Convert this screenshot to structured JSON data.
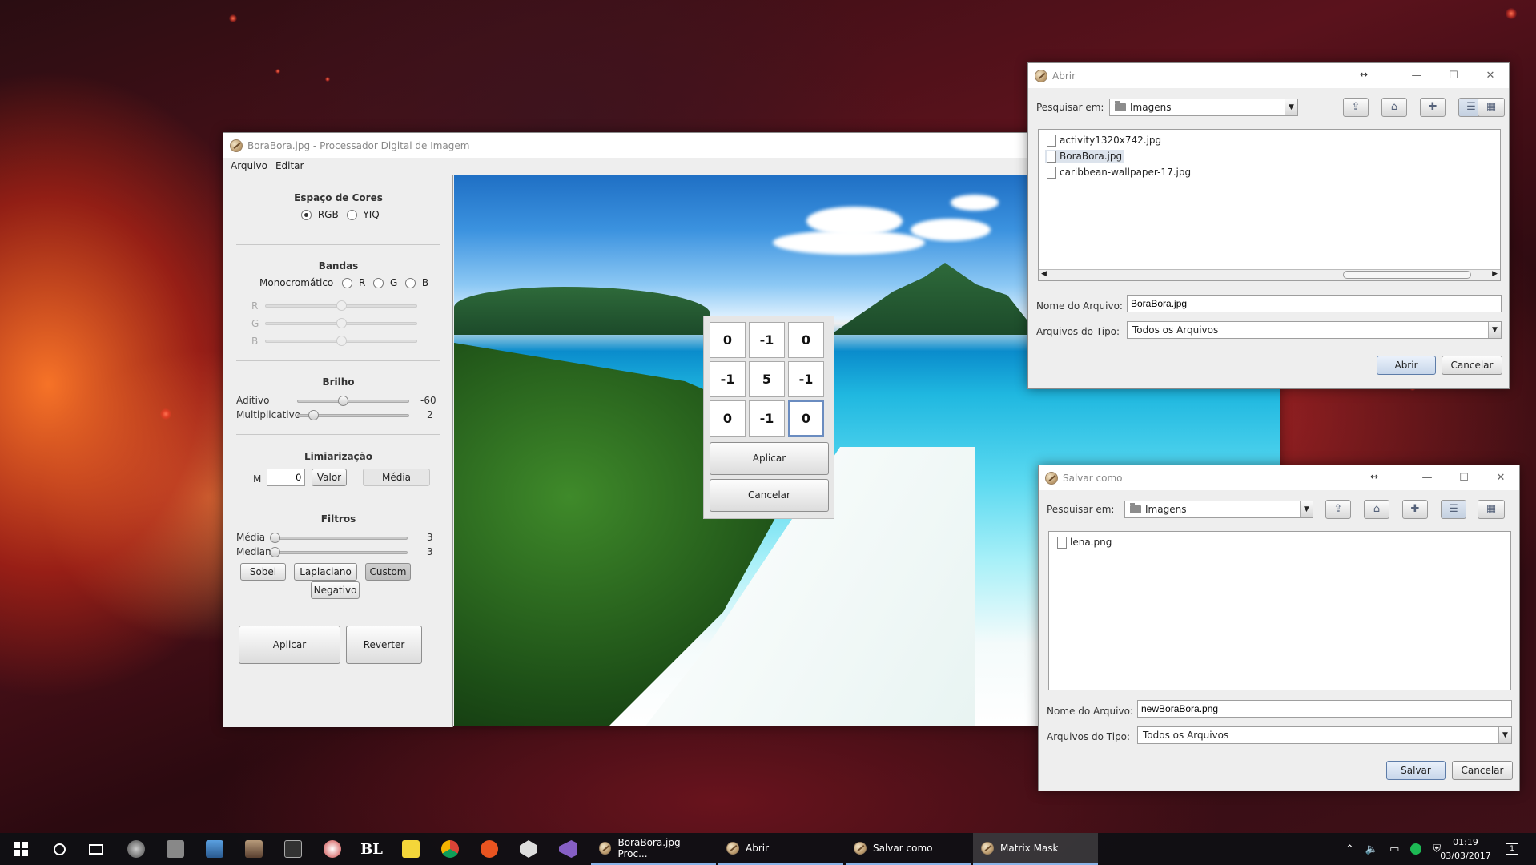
{
  "main_window": {
    "title": "BoraBora.jpg - Processador Digital de Imagem",
    "menu": [
      "Arquivo",
      "Editar"
    ],
    "color_space": {
      "title": "Espaço de Cores",
      "options": [
        "RGB",
        "YIQ"
      ],
      "selected": "RGB"
    },
    "bands": {
      "title": "Bandas",
      "mono_label": "Monocromático",
      "options": [
        "R",
        "G",
        "B"
      ],
      "sliders": [
        "R",
        "G",
        "B"
      ]
    },
    "brightness": {
      "title": "Brilho",
      "additive": {
        "label": "Aditivo",
        "value": "-60"
      },
      "multiplicative": {
        "label": "Multiplicativo",
        "value": "2"
      }
    },
    "threshold": {
      "title": "Limiarização",
      "m_label": "M",
      "m_value": "0",
      "valor_button": "Valor",
      "media_button": "Média"
    },
    "filters": {
      "title": "Filtros",
      "media": {
        "label": "Média",
        "value": "3"
      },
      "mediana": {
        "label": "Mediana",
        "value": "3"
      },
      "buttons": [
        "Sobel",
        "Laplaciano",
        "Custom",
        "Negativo"
      ]
    },
    "actions": {
      "apply": "Aplicar",
      "revert": "Reverter"
    }
  },
  "matrix_mask": {
    "values": [
      [
        "0",
        "-1",
        "0"
      ],
      [
        "-1",
        "5",
        "-1"
      ],
      [
        "0",
        "-1",
        "0"
      ]
    ],
    "apply": "Aplicar",
    "cancel": "Cancelar"
  },
  "open_dialog": {
    "title": "Abrir",
    "look_in_label": "Pesquisar em:",
    "look_in_value": "Imagens",
    "files": [
      "activity1320x742.jpg",
      "BoraBora.jpg",
      "caribbean-wallpaper-17.jpg"
    ],
    "selected_file": "BoraBora.jpg",
    "filename_label": "Nome do Arquivo:",
    "filename_value": "BoraBora.jpg",
    "filetype_label": "Arquivos do Tipo:",
    "filetype_value": "Todos os Arquivos",
    "ok": "Abrir",
    "cancel": "Cancelar"
  },
  "save_dialog": {
    "title": "Salvar como",
    "look_in_label": "Pesquisar em:",
    "look_in_value": "Imagens",
    "files": [
      "lena.png"
    ],
    "filename_label": "Nome do Arquivo:",
    "filename_value": "newBoraBora.png",
    "filetype_label": "Arquivos do Tipo:",
    "filetype_value": "Todos os Arquivos",
    "ok": "Salvar",
    "cancel": "Cancelar"
  },
  "taskbar": {
    "tasks": [
      "BoraBora.jpg - Proc...",
      "Abrir",
      "Salvar como",
      "Matrix Mask"
    ],
    "active_task": "Matrix Mask",
    "time": "01:19",
    "date": "03/03/2017",
    "notification_count": "1",
    "pinned_icons": [
      "steam-icon",
      "files-icon",
      "monitor-icon",
      "game-icon",
      "arena-icon",
      "paint-icon",
      "bl-icon",
      "sticky-notes-icon",
      "chrome-icon",
      "ubuntu-icon",
      "unity-icon",
      "visual-studio-icon"
    ],
    "bl_label": "BL"
  }
}
